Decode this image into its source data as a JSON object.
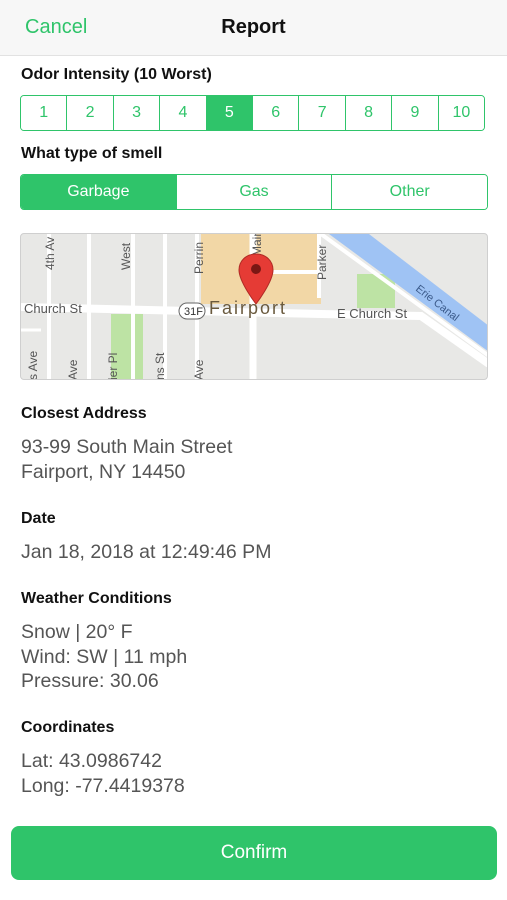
{
  "nav": {
    "cancel_label": "Cancel",
    "title": "Report"
  },
  "intensity": {
    "label": "Odor Intensity (10 Worst)",
    "options": [
      "1",
      "2",
      "3",
      "4",
      "5",
      "6",
      "7",
      "8",
      "9",
      "10"
    ],
    "selected": "5"
  },
  "smell": {
    "label": "What type of smell",
    "options": [
      "Garbage",
      "Gas",
      "Other"
    ],
    "selected": "Garbage"
  },
  "map": {
    "town_label": "Fairport",
    "streets": {
      "west_church": "Church St",
      "east_church": "E Church St",
      "route_badge": "31F",
      "fourth_ave": "4th Av",
      "west": "West",
      "perrin": "Perrin",
      "main": "Main",
      "parker": "Parker",
      "erie_canal": "Erie Canal",
      "s_ave_1": "s Ave",
      "s_ave_2": "Ave",
      "tier_pl": "ier Pl",
      "ns_st": "ns St",
      "ave_3": "Ave"
    },
    "water_color": "#9fc3f4",
    "park_color": "#bde3a4",
    "building_color": "#f2d7a6",
    "pin_color": "#e53b35"
  },
  "address": {
    "label": "Closest Address",
    "line1": "93-99 South Main Street",
    "line2": "Fairport, NY 14450"
  },
  "date": {
    "label": "Date",
    "value": "Jan 18, 2018 at 12:49:46 PM"
  },
  "weather": {
    "label": "Weather Conditions",
    "line1": "Snow | 20° F",
    "line2": "Wind: SW | 11 mph",
    "line3": "Pressure: 30.06"
  },
  "coordinates": {
    "label": "Coordinates",
    "lat": "Lat: 43.0986742",
    "long": "Long: -77.4419378"
  },
  "confirm_label": "Confirm",
  "colors": {
    "accent": "#2fc46a",
    "text_dark": "#111111",
    "text_value": "#555555"
  }
}
